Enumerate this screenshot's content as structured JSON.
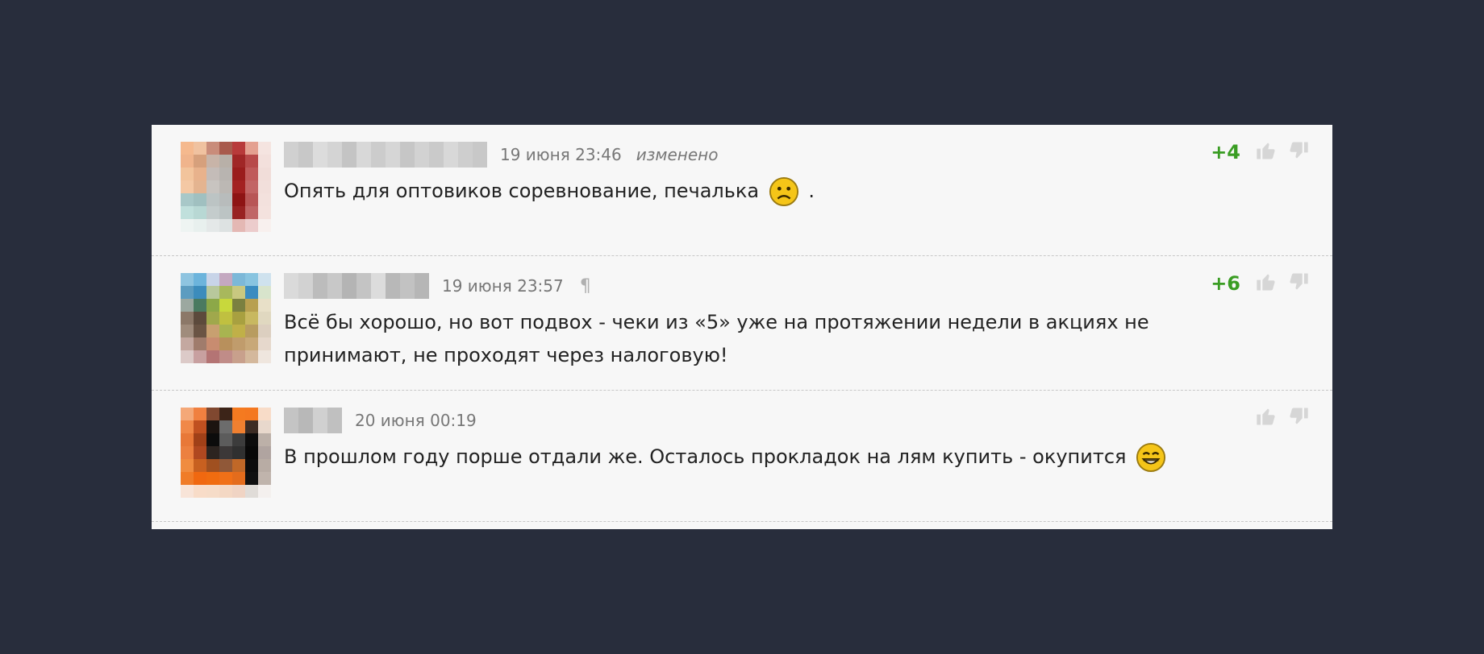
{
  "comments": [
    {
      "date": "19 июня 23:46",
      "edited": "изменено",
      "text_before": "Опять для оптовиков соревнование, печалька",
      "text_after": " .",
      "smiley": "sad-smiley-icon",
      "score": "+4",
      "avatar_colors": [
        [
          "#f5b98e",
          "#f0c2a0",
          "#c98c7a",
          "#a85a4c",
          "#b83a3a",
          "#e4a090",
          "#f5e4e0"
        ],
        [
          "#f0b48c",
          "#d6a07c",
          "#c8b4a8",
          "#b8b0a8",
          "#a02626",
          "#b84a4a",
          "#f3e0dc"
        ],
        [
          "#f2c49c",
          "#e8b28c",
          "#c4bcb8",
          "#b8b4b0",
          "#9a1c1c",
          "#c05a5a",
          "#f1ddd9"
        ],
        [
          "#f4c8a4",
          "#e4b490",
          "#c8c4c0",
          "#bcb8b4",
          "#a32121",
          "#c26565",
          "#f2dfdb"
        ],
        [
          "#a8c8c8",
          "#a0c0c0",
          "#bcc4c4",
          "#b8bcbc",
          "#8e1414",
          "#b85656",
          "#f3e1dd"
        ],
        [
          "#c0e0dc",
          "#b8d8d4",
          "#c4cccc",
          "#bcc4c4",
          "#982222",
          "#c06666",
          "#f4e2de"
        ],
        [
          "#eef4f2",
          "#e8f0ee",
          "#e4e8e8",
          "#dde2e2",
          "#e4b8b4",
          "#eccccc",
          "#f8f0ee"
        ]
      ]
    },
    {
      "date": "19 июня 23:57",
      "pilcrow": "¶",
      "text_before": "Всё бы хорошо, но вот подвох - чеки из «5» уже на протяжении недели в акциях не принимают, не проходят через налоговую!",
      "text_after": "",
      "smiley": "",
      "score": "+6",
      "avatar_colors": [
        [
          "#8ec4e0",
          "#6cb4dc",
          "#c8d4e8",
          "#c4a8c0",
          "#7cb8d8",
          "#88c4e0",
          "#cfe2ee"
        ],
        [
          "#5c9cc0",
          "#3c8cbc",
          "#b8c89c",
          "#a8b85c",
          "#c8c880",
          "#3a8cc0",
          "#d8e4cc"
        ],
        [
          "#9ca8a0",
          "#4a7a60",
          "#8ca848",
          "#c8d83c",
          "#7a8040",
          "#b8a050",
          "#e8e0c8"
        ],
        [
          "#8c7868",
          "#5c4a3c",
          "#a0a84c",
          "#c0c040",
          "#a8a040",
          "#c8b860",
          "#e0d8c0"
        ],
        [
          "#a08c7c",
          "#6a5444",
          "#c8a070",
          "#a8b450",
          "#c0b048",
          "#b89c60",
          "#dccfc0"
        ],
        [
          "#c4a8a0",
          "#a07c6c",
          "#c88c70",
          "#b8905c",
          "#c09c6c",
          "#c8a878",
          "#e6d8cc"
        ],
        [
          "#dccac8",
          "#c8a0a0",
          "#b47474",
          "#c08c88",
          "#c8a08c",
          "#d4b89c",
          "#efe6de"
        ]
      ]
    },
    {
      "date": "20 июня 00:19",
      "text_before": "В прошлом году порше отдали же. Осталось прокладок на лям купить - окупится",
      "text_after": "",
      "smiley": "laughing-smiley-icon",
      "score": "",
      "avatar_colors": [
        [
          "#f4a878",
          "#f08040",
          "#804830",
          "#3c2418",
          "#f47a20",
          "#f47820",
          "#f8dcc8"
        ],
        [
          "#f08848",
          "#c05020",
          "#1c1410",
          "#6c6c6c",
          "#f08030",
          "#3c2c24",
          "#e8d8cc"
        ],
        [
          "#e87838",
          "#a04018",
          "#0c0c0c",
          "#5c5c5c",
          "#3c3c3c",
          "#0c0c0c",
          "#bcb0a8"
        ],
        [
          "#ec8040",
          "#b04820",
          "#2c2420",
          "#3c3838",
          "#303030",
          "#080808",
          "#b0a4a0"
        ],
        [
          "#f08c40",
          "#c86020",
          "#a05020",
          "#905838",
          "#c06828",
          "#0c0c0c",
          "#b8aca4"
        ],
        [
          "#f07c28",
          "#f06810",
          "#f06c10",
          "#f07018",
          "#e46c1c",
          "#101010",
          "#c0b4ac"
        ],
        [
          "#f8e4d8",
          "#f8dcc8",
          "#f6dcc8",
          "#f4d8c4",
          "#f0d4c4",
          "#e0dcd8",
          "#f4f0ee"
        ]
      ]
    }
  ]
}
